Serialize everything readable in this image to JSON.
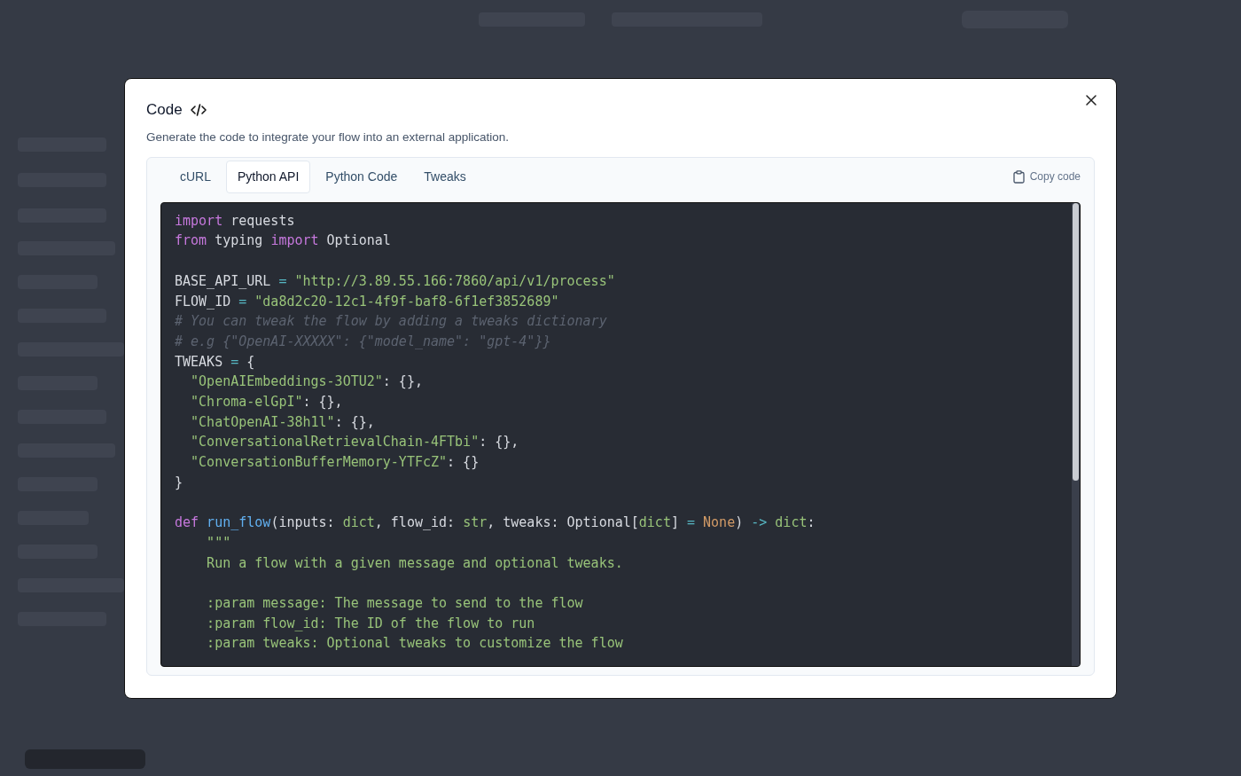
{
  "dialog": {
    "title": "Code",
    "subtitle": "Generate the code to integrate your flow into an external application."
  },
  "tabs": [
    {
      "label": "cURL",
      "selected": false
    },
    {
      "label": "Python API",
      "selected": true
    },
    {
      "label": "Python Code",
      "selected": false
    },
    {
      "label": "Tweaks",
      "selected": false
    }
  ],
  "copy_button": {
    "label": "Copy code"
  },
  "code": {
    "lines": [
      {
        "kind": "code",
        "tokens": [
          {
            "kind": "keyword",
            "text": "import"
          },
          {
            "kind": "plain",
            "text": " requests"
          }
        ]
      },
      {
        "kind": "code",
        "tokens": [
          {
            "kind": "keyword",
            "text": "from"
          },
          {
            "kind": "plain",
            "text": " typing "
          },
          {
            "kind": "keyword",
            "text": "import"
          },
          {
            "kind": "plain",
            "text": " Optional"
          }
        ]
      },
      {
        "kind": "blank"
      },
      {
        "kind": "code",
        "tokens": [
          {
            "kind": "plain",
            "text": "BASE_API_URL "
          },
          {
            "kind": "operator",
            "text": "="
          },
          {
            "kind": "string",
            "text": " \"http://3.89.55.166:7860/api/v1/process\""
          }
        ]
      },
      {
        "kind": "code",
        "tokens": [
          {
            "kind": "plain",
            "text": "FLOW_ID "
          },
          {
            "kind": "operator",
            "text": "="
          },
          {
            "kind": "string",
            "text": " \"da8d2c20-12c1-4f9f-baf8-6f1ef3852689\""
          }
        ]
      },
      {
        "kind": "code",
        "tokens": [
          {
            "kind": "comment",
            "text": "# You can tweak the flow by adding a tweaks dictionary"
          }
        ]
      },
      {
        "kind": "code",
        "tokens": [
          {
            "kind": "comment",
            "text": "# e.g {\"OpenAI-XXXXX\": {\"model_name\": \"gpt-4\"}}"
          }
        ]
      },
      {
        "kind": "code",
        "tokens": [
          {
            "kind": "plain",
            "text": "TWEAKS "
          },
          {
            "kind": "operator",
            "text": "="
          },
          {
            "kind": "plain",
            "text": " {"
          }
        ]
      },
      {
        "kind": "code",
        "tokens": [
          {
            "kind": "string",
            "text": "  \"OpenAIEmbeddings-3OTU2\""
          },
          {
            "kind": "plain",
            "text": ": {},"
          }
        ]
      },
      {
        "kind": "code",
        "tokens": [
          {
            "kind": "string",
            "text": "  \"Chroma-elGpI\""
          },
          {
            "kind": "plain",
            "text": ": {},"
          }
        ]
      },
      {
        "kind": "code",
        "tokens": [
          {
            "kind": "string",
            "text": "  \"ChatOpenAI-38h1l\""
          },
          {
            "kind": "plain",
            "text": ": {},"
          }
        ]
      },
      {
        "kind": "code",
        "tokens": [
          {
            "kind": "string",
            "text": "  \"ConversationalRetrievalChain-4FTbi\""
          },
          {
            "kind": "plain",
            "text": ": {},"
          }
        ]
      },
      {
        "kind": "code",
        "tokens": [
          {
            "kind": "string",
            "text": "  \"ConversationBufferMemory-YTFcZ\""
          },
          {
            "kind": "plain",
            "text": ": {}"
          }
        ]
      },
      {
        "kind": "code",
        "tokens": [
          {
            "kind": "plain",
            "text": "}"
          }
        ]
      },
      {
        "kind": "blank"
      },
      {
        "kind": "code",
        "tokens": [
          {
            "kind": "keyword",
            "text": "def"
          },
          {
            "kind": "function",
            "text": " run_flow"
          },
          {
            "kind": "plain",
            "text": "(inputs: "
          },
          {
            "kind": "builtin",
            "text": "dict"
          },
          {
            "kind": "plain",
            "text": ", flow_id: "
          },
          {
            "kind": "builtin",
            "text": "str"
          },
          {
            "kind": "plain",
            "text": ", tweaks: Optional["
          },
          {
            "kind": "builtin",
            "text": "dict"
          },
          {
            "kind": "plain",
            "text": "] "
          },
          {
            "kind": "operator",
            "text": "="
          },
          {
            "kind": "constant",
            "text": " None"
          },
          {
            "kind": "plain",
            "text": ") "
          },
          {
            "kind": "operator",
            "text": "->"
          },
          {
            "kind": "builtin",
            "text": " dict"
          },
          {
            "kind": "plain",
            "text": ":"
          }
        ]
      },
      {
        "kind": "code",
        "tokens": [
          {
            "kind": "string",
            "text": "    \"\"\""
          }
        ]
      },
      {
        "kind": "code",
        "tokens": [
          {
            "kind": "string",
            "text": "    Run a flow with a given message and optional tweaks."
          }
        ]
      },
      {
        "kind": "blank"
      },
      {
        "kind": "code",
        "tokens": [
          {
            "kind": "string",
            "text": "    :param message: The message to send to the flow"
          }
        ]
      },
      {
        "kind": "code",
        "tokens": [
          {
            "kind": "string",
            "text": "    :param flow_id: The ID of the flow to run"
          }
        ]
      },
      {
        "kind": "code",
        "tokens": [
          {
            "kind": "string",
            "text": "    :param tweaks: Optional tweaks to customize the flow"
          }
        ]
      }
    ]
  }
}
